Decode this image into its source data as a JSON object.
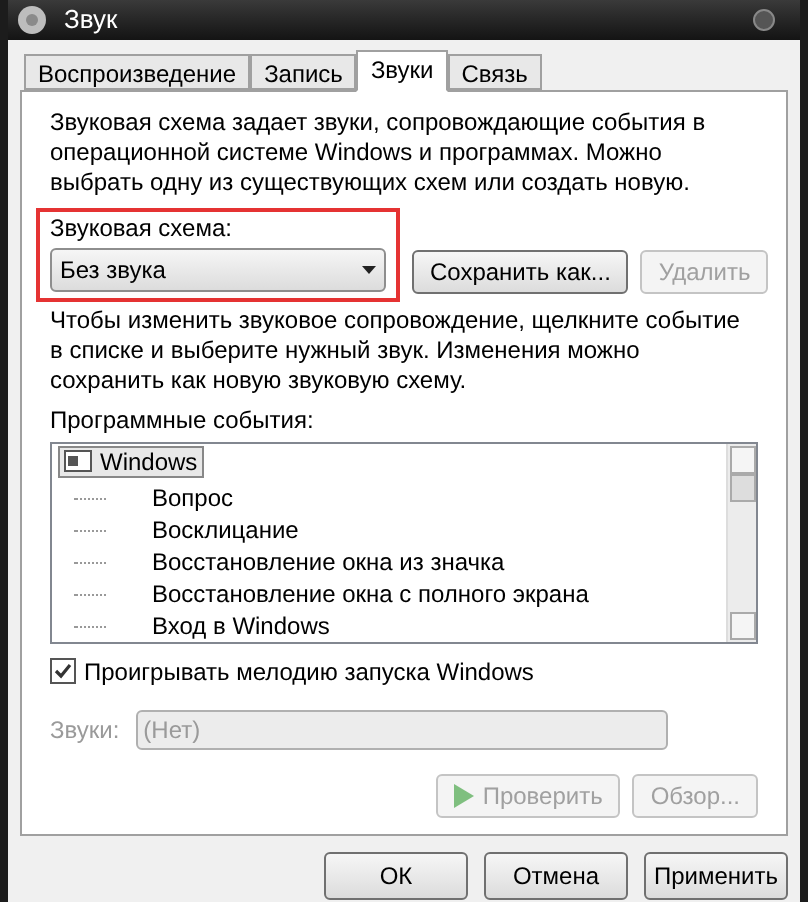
{
  "window": {
    "title": "Звук"
  },
  "tabs": [
    {
      "label": "Воспроизведение",
      "selected": false
    },
    {
      "label": "Запись",
      "selected": false
    },
    {
      "label": "Звуки",
      "selected": true
    },
    {
      "label": "Связь",
      "selected": false
    }
  ],
  "intro": "Звуковая схема задает звуки, сопровождающие события в операционной системе Windows и программах. Можно выбрать одну из существующих схем или создать новую.",
  "scheme": {
    "label": "Звуковая схема:",
    "value": "Без звука",
    "highlighted": true,
    "buttons": [
      {
        "label": "Сохранить как...",
        "disabled": false
      },
      {
        "label": "Удалить",
        "disabled": true
      }
    ]
  },
  "hint": "Чтобы изменить звуковое сопровождение, щелкните событие в списке и выберите нужный звук. Изменения можно сохранить как новую звуковую схему.",
  "events": {
    "label": "Программные события:",
    "tree": [
      {
        "label": "Windows",
        "selected": true,
        "children": [
          {
            "label": "Вопрос",
            "selected": false
          },
          {
            "label": "Восклицание",
            "selected": false
          },
          {
            "label": "Восстановление окна из значка",
            "selected": false
          },
          {
            "label": "Восстановление окна с полного экрана",
            "selected": false
          },
          {
            "label": "Вход в Windows",
            "selected": false
          }
        ]
      }
    ]
  },
  "startup": {
    "label": "Проигрывать мелодию запуска Windows",
    "checked": true
  },
  "sounds": {
    "label": "Звуки:",
    "value": "(Нет)",
    "disabled": true
  },
  "sound_buttons": [
    {
      "label": "Проверить",
      "kind": "play",
      "disabled": true
    },
    {
      "label": "Обзор...",
      "kind": "plain",
      "disabled": true
    }
  ],
  "dialog_buttons": [
    "ОК",
    "Отмена",
    "Применить"
  ]
}
